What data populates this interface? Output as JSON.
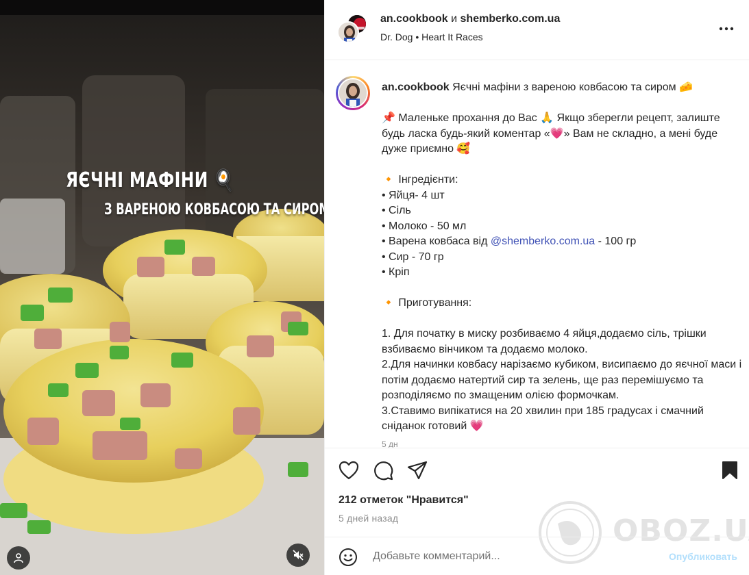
{
  "media": {
    "title": "ЯЄЧНІ МАФІНИ",
    "title_emoji": "🍳",
    "subtitle": "З ВАРЕНОЮ КОВБАСОЮ ТА СИРОМ",
    "subtitle_emoji": "🧀"
  },
  "header": {
    "username": "an.cookbook",
    "and": " и ",
    "collaborator": "shemberko.com.ua",
    "audio_artist": "Dr. Dog",
    "audio_separator": " • ",
    "audio_track": "Heart It Races"
  },
  "caption": {
    "username": "an.cookbook",
    "title": " Яєчні мафіни з вареною ковбасою та сиром 🧀",
    "request": "📌 Маленьке прохання до Вас 🙏 Якщо зберегли рецепт, залиште будь ласка будь-який коментар «💗» Вам не складно, а мені буде дуже приємно 🥰",
    "ingredients_header": "🔸 Інгредієнти:",
    "ingredients": [
      "• Яйця- 4 шт",
      "• Сіль",
      "• Молоко - 50 мл"
    ],
    "sausage_prefix": "• Варена ковбаса від ",
    "sausage_link": "@shemberko.com.ua",
    "sausage_suffix": " - 100 гр",
    "ingredients_tail": [
      "• Сир - 70 гр",
      "• Кріп"
    ],
    "steps_header": "🔸 Приготування:",
    "steps": [
      "1. Для початку в миску розбиваємо 4 яйця,додаємо сіль, трішки взбиваємо вінчиком та додаємо молоко.",
      "2.Для начинки ковбасу нарізаємо кубиком, висипаємо до яєчної маси і потім додаємо натертий сир та зелень, ще раз перемішуємо та розподіляємо по змащеним олією формочкам.",
      "3.Ставимо випікатися на 20 хвилин при 185 градусах і смачний сніданок готовий 💗"
    ],
    "time": "5 дн"
  },
  "stats": {
    "likes": "212 отметок \"Нравится\"",
    "date": "5 дней назад"
  },
  "comment": {
    "placeholder": "Добавьте комментарий...",
    "post_label": "Опубликовать"
  },
  "watermark": {
    "text": "OBOZ.UA"
  },
  "icons": {
    "like": "heart-icon",
    "comment": "comment-icon",
    "share": "send-icon",
    "save": "bookmark-icon",
    "more": "more-dots-icon",
    "emoji": "smiley-icon",
    "mute": "speaker-muted-icon",
    "tagged": "user-tag-icon"
  }
}
